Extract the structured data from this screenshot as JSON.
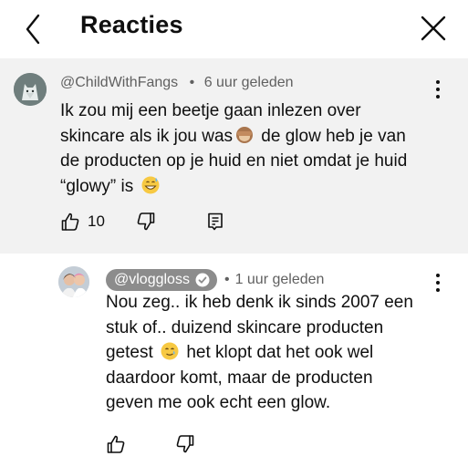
{
  "header": {
    "title": "Reacties",
    "back_icon": "chevron-left-icon",
    "close_icon": "close-icon"
  },
  "comments": [
    {
      "author": "@ChildWithFangs",
      "time": "6 uur geleden",
      "text_parts": [
        "Ik zou mij een beetje gaan inlezen over skincare als ik jou was",
        " de glow heb je van de producten op je huid en niet omdat je huid “glowy” is "
      ],
      "emojis": [
        "see-no-evil-monkey-emoji",
        "grinning-sweat-emoji"
      ],
      "likes": "10"
    }
  ],
  "reply": {
    "author": "@vloggloss",
    "verified": true,
    "time": "1 uur geleden",
    "text_parts": [
      "Nou zeg.. ik heb denk ik sinds 2007 een stuk of.. duizend skincare producten getest ",
      " het klopt dat het ook wel daardoor komt, maar de producten geven me ook echt een glow."
    ],
    "emojis": [
      "smiling-tear-emoji"
    ]
  },
  "colors": {
    "main_comment_bg": "#f2f2f2",
    "meta_text": "#606060",
    "handle_badge_bg": "#8c8c8c"
  },
  "separator": "•"
}
